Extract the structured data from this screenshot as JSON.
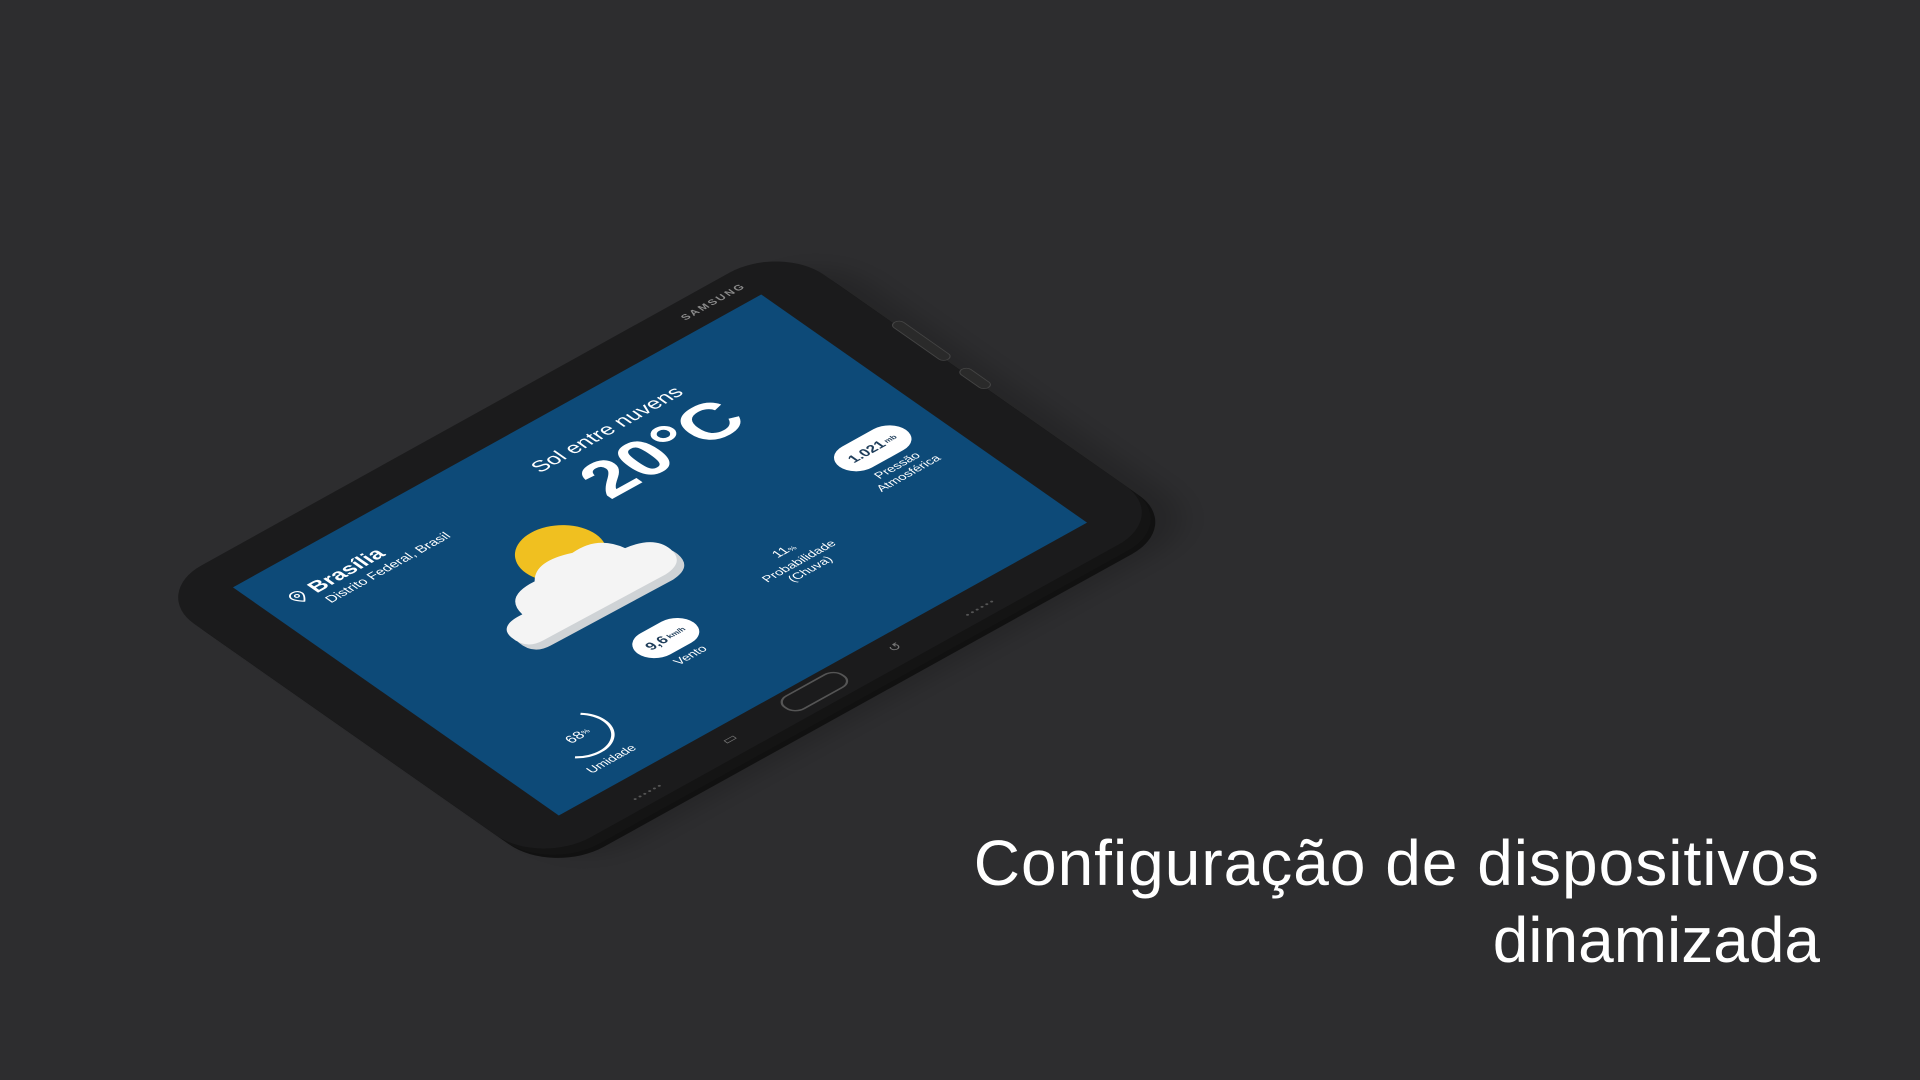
{
  "device": {
    "brand": "SAMSUNG"
  },
  "weather": {
    "city": "Brasília",
    "region": "Distrito Federal, Brasil",
    "condition": "Sol entre nuvens",
    "temperature": "20°C",
    "metrics": {
      "humidity": {
        "value": "68",
        "unit": "%",
        "label": "Umidade"
      },
      "wind": {
        "value": "9,6",
        "unit": "km/h",
        "label": "Vento"
      },
      "rain": {
        "value": "11",
        "unit": "%",
        "label": "Probabilidade\n(Chuva)"
      },
      "pressure": {
        "value": "1.021",
        "unit": "mb",
        "label": "Pressão\nAtmosférica"
      }
    },
    "icons": [
      "location-pin-icon",
      "sun-icon",
      "cloud-icon"
    ]
  },
  "headline": {
    "line1": "Configuração de dispositivos",
    "line2": "dinamizada"
  },
  "colors": {
    "background": "#2d2d2f",
    "screen": "#0d4a78",
    "sun": "#f0c020",
    "bezel": "#1b1b1c"
  }
}
